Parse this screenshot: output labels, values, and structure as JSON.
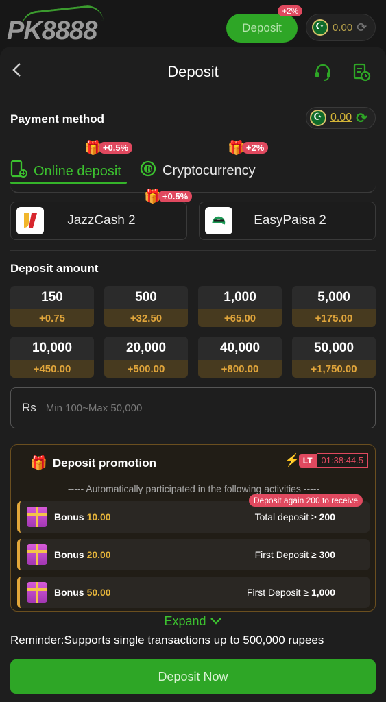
{
  "topbar": {
    "logo": "PK8888",
    "deposit_label": "Deposit",
    "deposit_badge": "+2%",
    "balance": "0.00"
  },
  "header": {
    "title": "Deposit",
    "back_icon": "chevron-left-icon",
    "support_icon": "headset-icon",
    "history_icon": "records-icon"
  },
  "payment": {
    "label": "Payment method",
    "balance": "0.00",
    "tabs": [
      {
        "label": "Online deposit",
        "badge": "+0.5%",
        "active": true
      },
      {
        "label": "Cryptocurrency",
        "badge": "+2%",
        "active": false
      }
    ],
    "channels": [
      {
        "name": "JazzCash 2",
        "badge": "+0.5%",
        "logo": "J"
      },
      {
        "name": "EasyPaisa 2",
        "logo": "e"
      }
    ]
  },
  "amount": {
    "label": "Deposit amount",
    "options": [
      {
        "value": "150",
        "bonus": "+0.75"
      },
      {
        "value": "500",
        "bonus": "+32.50"
      },
      {
        "value": "1,000",
        "bonus": "+65.00"
      },
      {
        "value": "5,000",
        "bonus": "+175.00"
      },
      {
        "value": "10,000",
        "bonus": "+450.00"
      },
      {
        "value": "20,000",
        "bonus": "+500.00"
      },
      {
        "value": "40,000",
        "bonus": "+800.00"
      },
      {
        "value": "50,000",
        "bonus": "+1,750.00"
      }
    ],
    "currency": "Rs",
    "placeholder": "Min 100~Max 50,000"
  },
  "promotion": {
    "title": "Deposit promotion",
    "lt": "LT",
    "timer": "01:38:44.5",
    "auto_text": "----- Automatically participated in the following activities -----",
    "again_badge": "Deposit again 200 to receive",
    "items": [
      {
        "label": "Bonus",
        "amount": "10.00",
        "cond_text": "Total deposit ≥",
        "cond_value": "200"
      },
      {
        "label": "Bonus",
        "amount": "20.00",
        "cond_text": "First Deposit ≥",
        "cond_value": "300"
      },
      {
        "label": "Bonus",
        "amount": "50.00",
        "cond_text": "First Deposit ≥",
        "cond_value": "1,000"
      }
    ]
  },
  "expand_label": "Expand",
  "reminder": "Reminder:Supports single transactions up to 500,000 rupees",
  "deposit_now": "Deposit Now",
  "colors": {
    "accent": "#2ea626",
    "badge": "#e0495f",
    "gold": "#e6b53b"
  }
}
